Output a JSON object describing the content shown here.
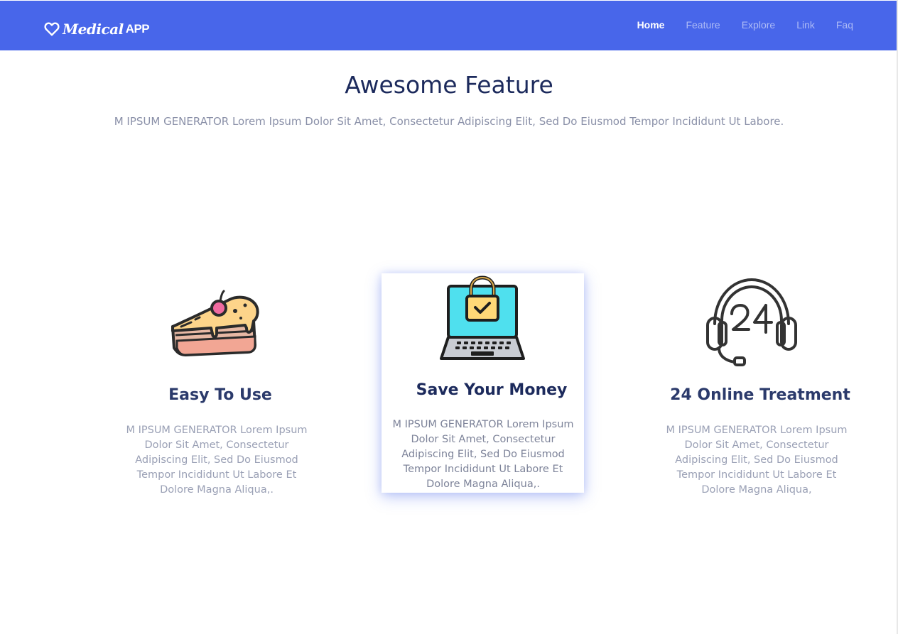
{
  "brand": {
    "name": "Medical",
    "suffix": "APP"
  },
  "nav": {
    "items": [
      {
        "label": "Home",
        "active": true
      },
      {
        "label": "Feature",
        "active": false
      },
      {
        "label": "Explore",
        "active": false
      },
      {
        "label": "Link",
        "active": false
      },
      {
        "label": "Faq",
        "active": false
      }
    ]
  },
  "section": {
    "title": "Awesome Feature",
    "subtitle": "M IPSUM GENERATOR Lorem Ipsum Dolor Sit Amet, Consectetur Adipiscing Elit, Sed Do Eiusmod Tempor Incididunt Ut Labore."
  },
  "features": [
    {
      "icon": "cake-slice-icon",
      "title": "Easy To Use",
      "text": "M IPSUM GENERATOR Lorem Ipsum Dolor Sit Amet, Consectetur Adipiscing Elit, Sed Do Eiusmod Tempor Incididunt Ut Labore Et Dolore Magna Aliqua,."
    },
    {
      "icon": "laptop-lock-icon",
      "title": "Save Your Money",
      "text": "M IPSUM GENERATOR Lorem Ipsum Dolor Sit Amet, Consectetur Adipiscing Elit, Sed Do Eiusmod Tempor Incididunt Ut Labore Et Dolore Magna Aliqua,."
    },
    {
      "icon": "headset-24-icon",
      "title": "24 Online Treatment",
      "text": "M IPSUM GENERATOR Lorem Ipsum Dolor Sit Amet, Consectetur Adipiscing Elit, Sed Do Eiusmod Tempor Incididunt Ut Labore Et Dolore Magna Aliqua,"
    }
  ],
  "colors": {
    "navbar": "#4866ea",
    "title": "#1c2a5c",
    "muted_text": "#9aa0b5"
  }
}
